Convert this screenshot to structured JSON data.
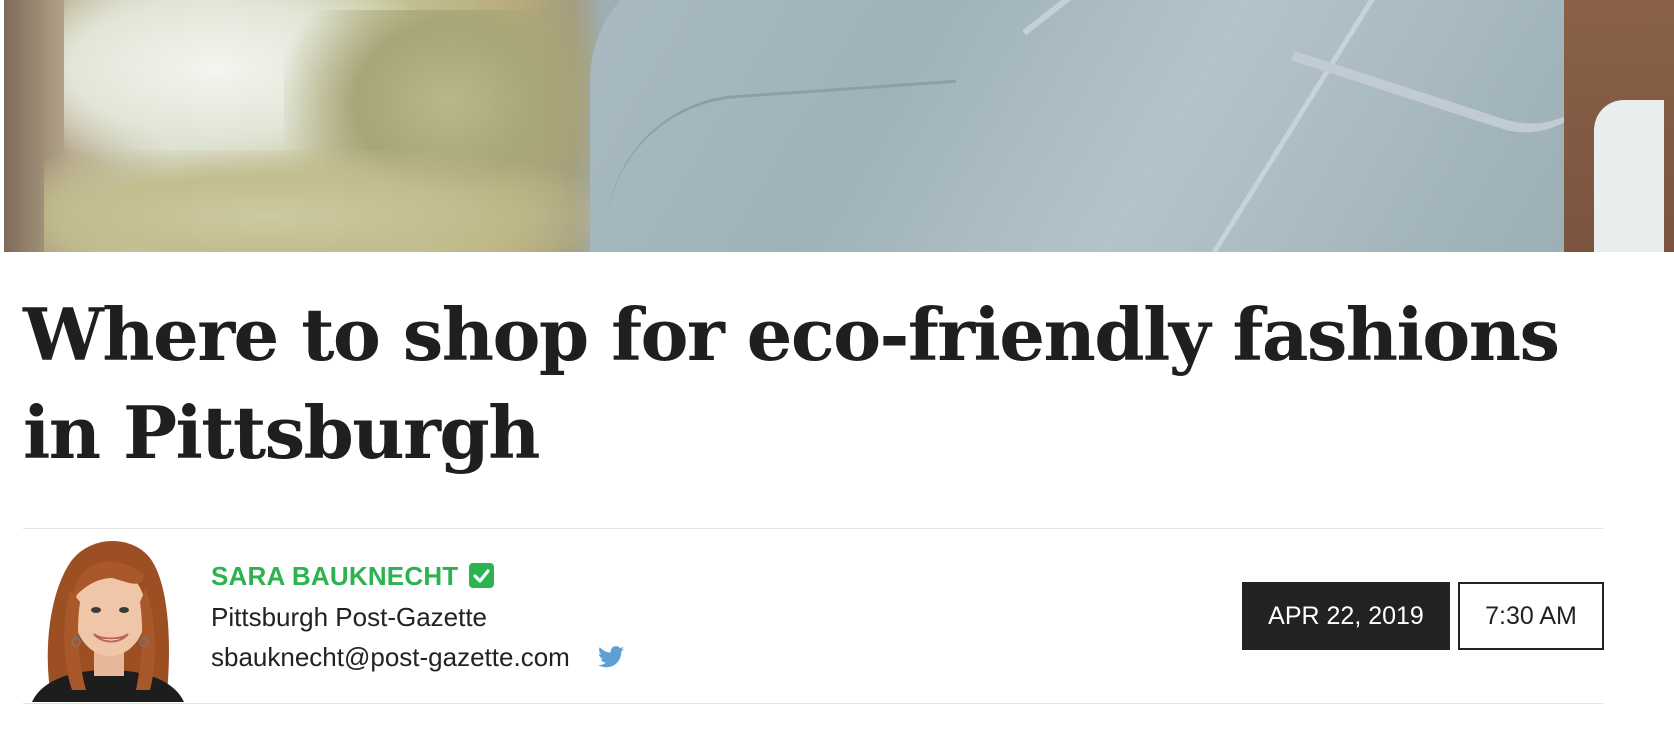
{
  "article": {
    "headline": "Where to shop for eco-friendly fashions in Pittsburgh",
    "hero_image": "cropped photo of person in light blue-gray shirt outdoors"
  },
  "byline": {
    "author_name": "SARA BAUKNECHT",
    "organization": "Pittsburgh Post-Gazette",
    "email": "sbauknecht@post-gazette.com",
    "verified_icon": "check-square-icon",
    "social_icon": "twitter-icon"
  },
  "published": {
    "date": "APR 22, 2019",
    "time": "7:30 AM"
  },
  "colors": {
    "author_accent": "#2cb24f",
    "twitter_blue": "#5da0d3",
    "date_badge_bg": "#222222",
    "headline_text": "#1f1f1f"
  }
}
